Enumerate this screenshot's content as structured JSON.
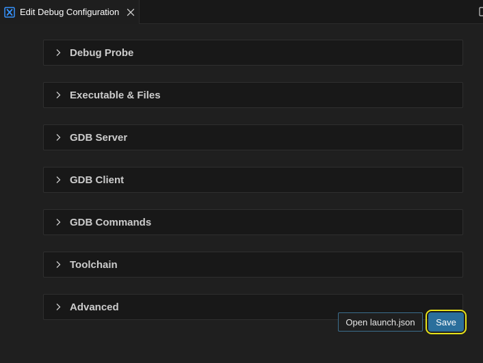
{
  "tab": {
    "title": "Edit Debug Configuration",
    "icon": "debug-config-x-icon",
    "close_icon": "close-icon"
  },
  "sections": [
    {
      "label": "Debug Probe",
      "expanded": false
    },
    {
      "label": "Executable & Files",
      "expanded": false
    },
    {
      "label": "GDB Server",
      "expanded": false
    },
    {
      "label": "GDB Client",
      "expanded": false
    },
    {
      "label": "GDB Commands",
      "expanded": false
    },
    {
      "label": "Toolchain",
      "expanded": false
    },
    {
      "label": "Advanced",
      "expanded": false
    }
  ],
  "actions": {
    "open_launch_label": "Open launch.json",
    "save_label": "Save"
  },
  "colors": {
    "accent": "#2b6f9c",
    "highlight_ring": "#e8e319",
    "tab_icon": "#3794ff"
  }
}
